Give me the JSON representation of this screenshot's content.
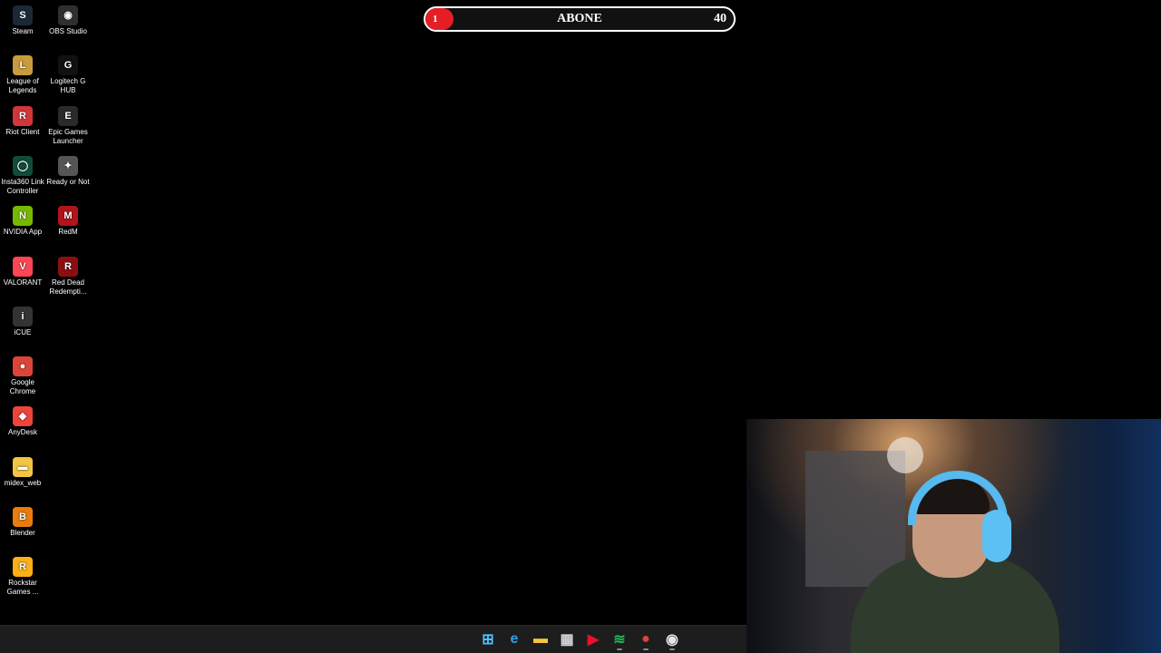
{
  "goal_bar": {
    "current": "1",
    "title": "ABONE",
    "target": "40",
    "progress_fraction": 0.09,
    "fill_color": "#e51e25"
  },
  "desktop_icons": [
    {
      "label": "Steam",
      "icon": "steam-icon",
      "color": "#1b2838",
      "glyph": "S"
    },
    {
      "label": "OBS Studio",
      "icon": "obs-icon",
      "color": "#302e31",
      "glyph": "◉"
    },
    {
      "label": "League of Legends",
      "icon": "league-icon",
      "color": "#c89b3c",
      "glyph": "L"
    },
    {
      "label": "Logitech G HUB",
      "icon": "logitech-icon",
      "color": "#111111",
      "glyph": "G"
    },
    {
      "label": "Riot Client",
      "icon": "riot-icon",
      "color": "#d13639",
      "glyph": "R"
    },
    {
      "label": "Epic Games Launcher",
      "icon": "epic-icon",
      "color": "#2a2a2a",
      "glyph": "E"
    },
    {
      "label": "Insta360 Link Controller",
      "icon": "insta360-icon",
      "color": "#0f4d3a",
      "glyph": "◯"
    },
    {
      "label": "Ready or Not",
      "icon": "ready-or-not-icon",
      "color": "#555555",
      "glyph": "✦"
    },
    {
      "label": "NVIDIA App",
      "icon": "nvidia-icon",
      "color": "#76b900",
      "glyph": "N"
    },
    {
      "label": "RedM",
      "icon": "redm-icon",
      "color": "#b3131b",
      "glyph": "M"
    },
    {
      "label": "VALORANT",
      "icon": "valorant-icon",
      "color": "#ff4655",
      "glyph": "V"
    },
    {
      "label": "Red Dead Redempti...",
      "icon": "red-dead-icon",
      "color": "#8b0f12",
      "glyph": "R"
    },
    {
      "label": "iCUE",
      "icon": "icue-icon",
      "color": "#333333",
      "glyph": "i"
    },
    {
      "label": "Google Chrome",
      "icon": "chrome-icon",
      "color": "#db4437",
      "glyph": "●"
    },
    {
      "label": "AnyDesk",
      "icon": "anydesk-icon",
      "color": "#ef443b",
      "glyph": "◆"
    },
    {
      "label": "midex_web",
      "icon": "folder-icon",
      "color": "#f4c542",
      "glyph": "▬"
    },
    {
      "label": "Blender",
      "icon": "blender-icon",
      "color": "#e87d0d",
      "glyph": "B"
    },
    {
      "label": "Rockstar Games ...",
      "icon": "rockstar-icon",
      "color": "#fcaf17",
      "glyph": "R"
    }
  ],
  "taskbar": {
    "icons": [
      {
        "name": "windows-start-icon",
        "color": "#4cc2ff",
        "glyph": "⊞"
      },
      {
        "name": "edge-icon",
        "color": "#2ea1e6",
        "glyph": "e"
      },
      {
        "name": "file-explorer-icon",
        "color": "#f5c542",
        "glyph": "▬"
      },
      {
        "name": "microsoft-store-icon",
        "color": "#d9d9d9",
        "glyph": "▦"
      },
      {
        "name": "media-player-icon",
        "color": "#e8112d",
        "glyph": "▶"
      },
      {
        "name": "spotify-icon",
        "color": "#1db954",
        "glyph": "≋"
      },
      {
        "name": "chrome-icon",
        "color": "#db4437",
        "glyph": "●"
      },
      {
        "name": "obs-icon",
        "color": "#e6e6e6",
        "glyph": "◉"
      }
    ]
  }
}
